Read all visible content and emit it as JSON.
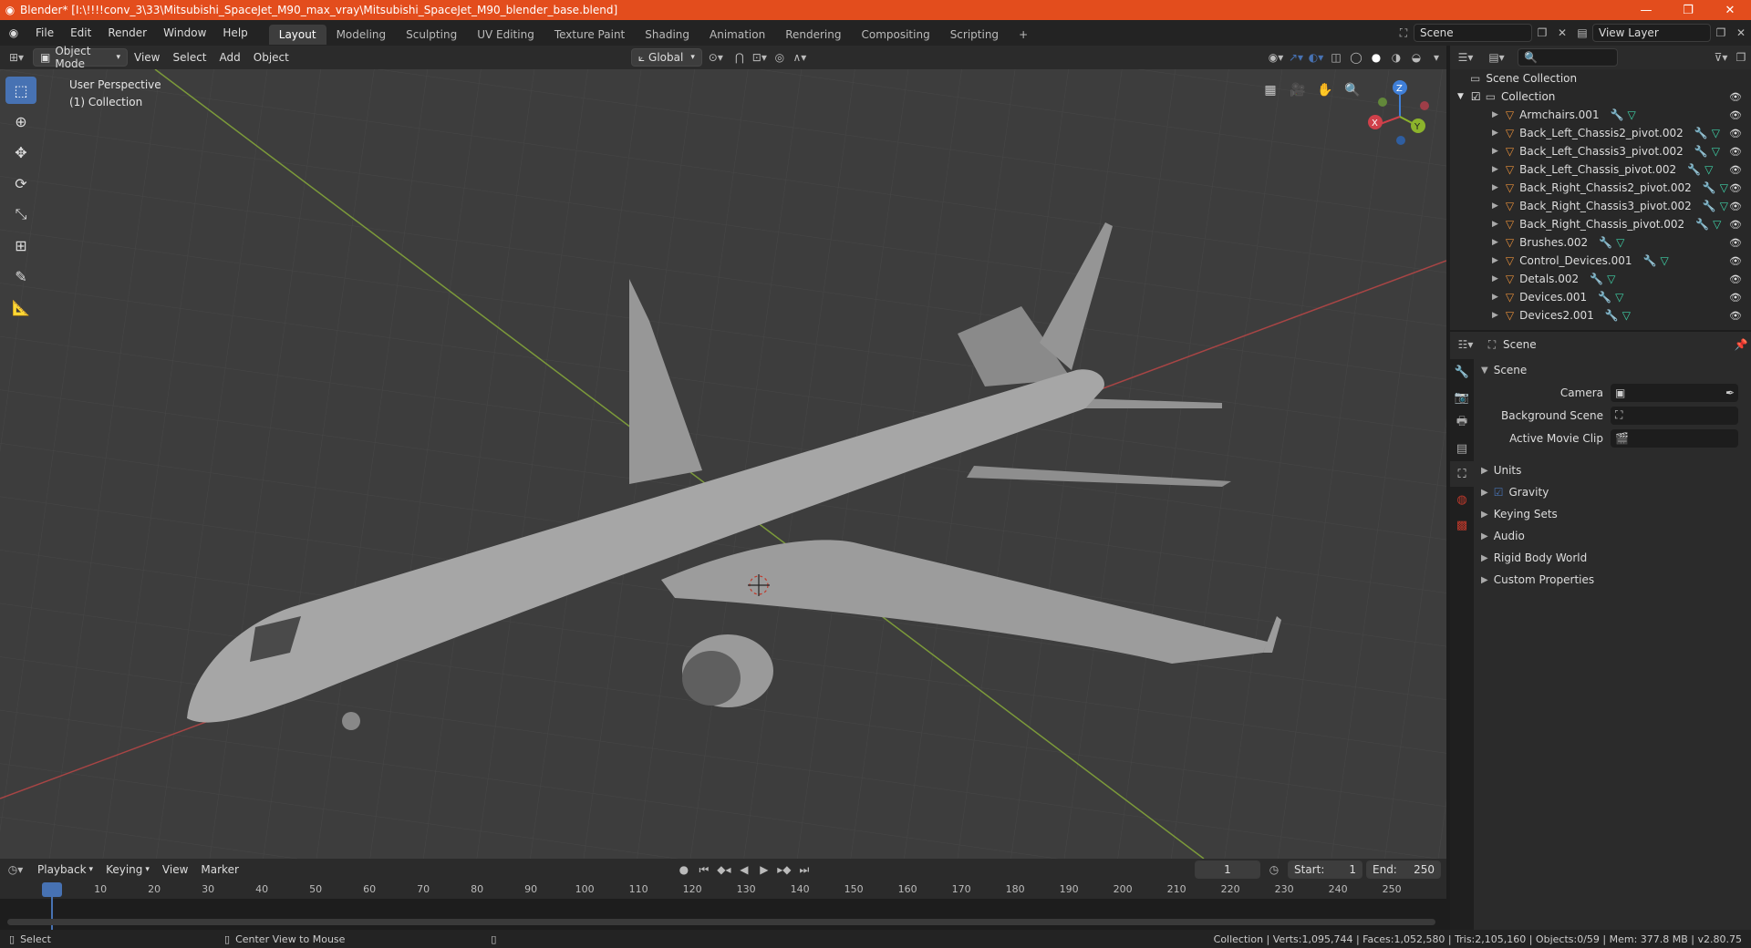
{
  "window": {
    "title": "Blender* [I:\\!!!!conv_3\\33\\Mitsubishi_SpaceJet_M90_max_vray\\Mitsubishi_SpaceJet_M90_blender_base.blend]",
    "minimize": "—",
    "maximize": "❐",
    "close": "✕"
  },
  "menu": {
    "items": [
      "File",
      "Edit",
      "Render",
      "Window",
      "Help"
    ],
    "workspaces": [
      "Layout",
      "Modeling",
      "Sculpting",
      "UV Editing",
      "Texture Paint",
      "Shading",
      "Animation",
      "Rendering",
      "Compositing",
      "Scripting"
    ],
    "active_workspace": "Layout",
    "add_workspace": "+",
    "scene": "Scene",
    "view_layer": "View Layer"
  },
  "viewport_header": {
    "mode": "Object Mode",
    "menus": [
      "View",
      "Select",
      "Add",
      "Object"
    ],
    "orientation": "Global"
  },
  "viewport": {
    "view_name": "User Perspective",
    "collection": "(1) Collection",
    "gizmo_axes": {
      "x": "X",
      "y": "Y",
      "z": "Z"
    }
  },
  "timeline": {
    "menus": [
      "Playback",
      "Keying",
      "View",
      "Marker"
    ],
    "current_frame": "1",
    "start_label": "Start:",
    "start": "1",
    "end_label": "End:",
    "end": "250",
    "ticks": [
      "1",
      "10",
      "20",
      "30",
      "40",
      "50",
      "60",
      "70",
      "80",
      "90",
      "100",
      "110",
      "120",
      "130",
      "140",
      "150",
      "160",
      "170",
      "180",
      "190",
      "200",
      "210",
      "220",
      "230",
      "240",
      "250"
    ]
  },
  "status": {
    "select": "Select",
    "center_view": "Center View to Mouse",
    "stats": "Collection | Verts:1,095,744 | Faces:1,052,580 | Tris:2,105,160 | Objects:0/59 | Mem: 377.8 MB | v2.80.75"
  },
  "outliner": {
    "root": "Scene Collection",
    "collection": "Collection",
    "items": [
      "Armchairs.001",
      "Back_Left_Chassis2_pivot.002",
      "Back_Left_Chassis3_pivot.002",
      "Back_Left_Chassis_pivot.002",
      "Back_Right_Chassis2_pivot.002",
      "Back_Right_Chassis3_pivot.002",
      "Back_Right_Chassis_pivot.002",
      "Brushes.002",
      "Control_Devices.001",
      "Detals.002",
      "Devices.001",
      "Devices2.001"
    ]
  },
  "properties": {
    "context": "Scene",
    "panel_title": "Scene",
    "camera_label": "Camera",
    "background_label": "Background Scene",
    "movie_clip_label": "Active Movie Clip",
    "panels": [
      "Units",
      "Gravity",
      "Keying Sets",
      "Audio",
      "Rigid Body World",
      "Custom Properties"
    ]
  },
  "colors": {
    "title_bar": "#e34d1d",
    "accent": "#4772b3",
    "x_axis": "#d0404a",
    "y_axis": "#8cb32c",
    "z_axis": "#3f7fd8"
  }
}
